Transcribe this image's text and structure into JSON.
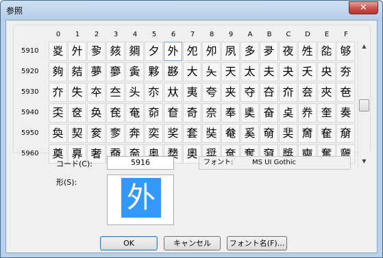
{
  "window": {
    "title": "参照",
    "close_glyph": "✕"
  },
  "columns": [
    "0",
    "1",
    "2",
    "3",
    "4",
    "5",
    "6",
    "7",
    "8",
    "9",
    "A",
    "B",
    "C",
    "D",
    "E",
    "F"
  ],
  "rows": [
    {
      "label": "5910",
      "chars": [
        "㚇",
        "㚈",
        "㚉",
        "㚊",
        "㚋",
        "夕",
        "外",
        "夗",
        "夘",
        "夙",
        "多",
        "夛",
        "夜",
        "夝",
        "夞",
        "够"
      ]
    },
    {
      "label": "5920",
      "chars": [
        "夠",
        "夡",
        "夢",
        "夣",
        "夤",
        "夥",
        "夦",
        "大",
        "夨",
        "天",
        "太",
        "夫",
        "夬",
        "夭",
        "央",
        "夯"
      ]
    },
    {
      "label": "5930",
      "chars": [
        "夰",
        "失",
        "夲",
        "夳",
        "头",
        "夵",
        "夶",
        "夷",
        "夸",
        "夹",
        "夺",
        "夻",
        "夼",
        "夽",
        "夾",
        "夿"
      ]
    },
    {
      "label": "5940",
      "chars": [
        "奀",
        "奁",
        "奂",
        "奃",
        "奄",
        "奅",
        "奆",
        "奇",
        "奈",
        "奉",
        "奊",
        "奋",
        "奌",
        "奍",
        "奎",
        "奏"
      ]
    },
    {
      "label": "5950",
      "chars": [
        "奐",
        "契",
        "奒",
        "奓",
        "奔",
        "奕",
        "奖",
        "套",
        "奘",
        "奙",
        "奚",
        "奛",
        "奜",
        "奝",
        "奞",
        "奟"
      ]
    },
    {
      "label": "5960",
      "chars": [
        "奠",
        "奡",
        "奢",
        "奣",
        "奤",
        "奥",
        "奦",
        "奧",
        "奨",
        "奩",
        "奪",
        "奫",
        "奬",
        "奭",
        "奮",
        "奯"
      ]
    }
  ],
  "selected": {
    "row": 0,
    "col": 6
  },
  "code_label": "コード(C):",
  "code_value": "5916",
  "shape_label": "形(S):",
  "preview_char": "外",
  "font_key": "フォント:",
  "font_value": "MS UI Gothic",
  "buttons": {
    "ok": "OK",
    "cancel": "キャンセル",
    "font_name": "フォント名(F)..."
  },
  "scroll": {
    "up": "▲",
    "down": "▼"
  },
  "colors": {
    "selection": "#3399ff",
    "window_frame": "#b9d1ea"
  }
}
